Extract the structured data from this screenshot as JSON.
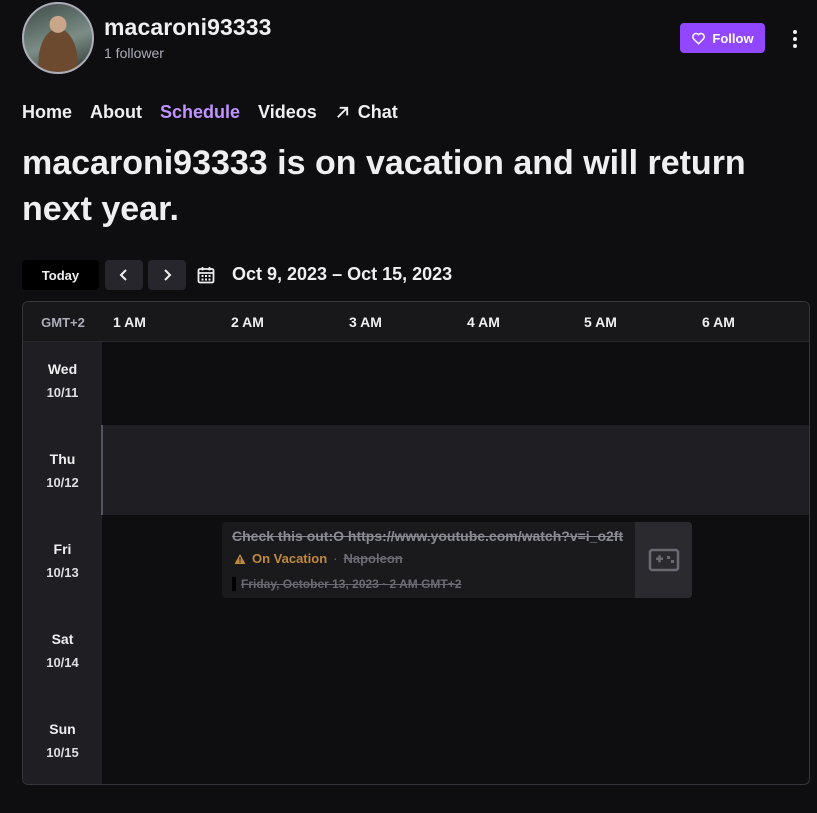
{
  "channel": {
    "name": "macaroni93333",
    "followers": "1 follower",
    "follow_label": "Follow"
  },
  "nav": {
    "items": [
      {
        "label": "Home",
        "active": false
      },
      {
        "label": "About",
        "active": false
      },
      {
        "label": "Schedule",
        "active": true
      },
      {
        "label": "Videos",
        "active": false
      },
      {
        "label": "Chat",
        "active": false,
        "icon": "arrow-up-right-icon"
      }
    ]
  },
  "vacation_message": "macaroni93333 is on vacation and will return next year.",
  "toolbar": {
    "today_label": "Today",
    "prev_icon": "chevron-left-icon",
    "next_icon": "chevron-right-icon",
    "calendar_icon": "calendar-icon",
    "date_range": "Oct 9, 2023 – Oct 15, 2023"
  },
  "schedule": {
    "timezone": "GMT+2",
    "hours": [
      "1 AM",
      "2 AM",
      "3 AM",
      "4 AM",
      "5 AM",
      "6 AM"
    ],
    "days": [
      {
        "name": "Wed",
        "date": "10/11"
      },
      {
        "name": "Thu",
        "date": "10/12"
      },
      {
        "name": "Fri",
        "date": "10/13"
      },
      {
        "name": "Sat",
        "date": "10/14"
      },
      {
        "name": "Sun",
        "date": "10/15"
      }
    ],
    "event": {
      "title": "Check this out:O https://www.youtube.com/watch?v=i_o2ft",
      "status": "On Vacation",
      "separator": "·",
      "category": "Napoleon",
      "time": "Friday, October 13, 2023 · 2 AM GMT+2",
      "thumbnail_icon": "gamepad-icon"
    }
  },
  "colors": {
    "accent": "#9147ff",
    "active_nav": "#bf94ff",
    "background": "#0e0e10",
    "vacation_warning": "#c08a3e"
  }
}
